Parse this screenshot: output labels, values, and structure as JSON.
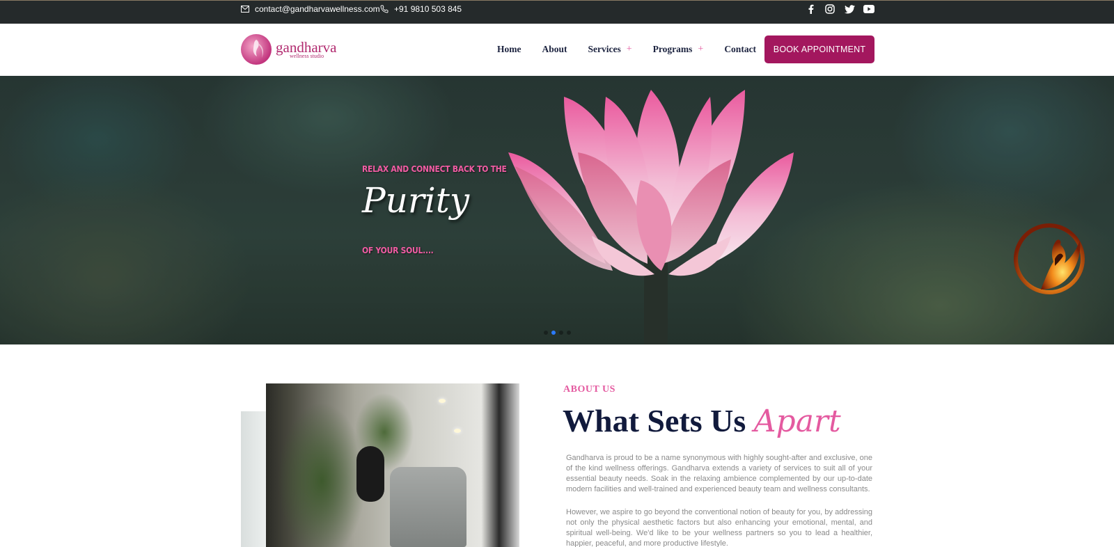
{
  "topbar": {
    "email": "contact@gandharvawellness.com",
    "phone": "+91 9810 503 845",
    "social_icons": [
      "facebook-icon",
      "instagram-icon",
      "twitter-icon",
      "youtube-icon"
    ]
  },
  "header": {
    "logo": {
      "name": "gandharva",
      "sub": "wellness studio"
    },
    "nav": [
      {
        "label": "Home",
        "has_submenu": false
      },
      {
        "label": "About",
        "has_submenu": false
      },
      {
        "label": "Services",
        "has_submenu": true
      },
      {
        "label": "Programs",
        "has_submenu": true
      },
      {
        "label": "Contact",
        "has_submenu": false
      }
    ],
    "submenu_indicator": "+",
    "book_button": "BOOK APPOINTMENT"
  },
  "hero": {
    "tagline_top": "RELAX AND CONNECT BACK TO THE",
    "title": "Purity",
    "tagline_bottom": "OF YOUR SOUL....",
    "slides_count": 4,
    "active_slide": 2
  },
  "about": {
    "label": "ABOUT US",
    "title_main": "What Sets Us",
    "title_accent": "Apart",
    "paragraph1": "Gandharva is proud to be a name synonymous with highly sought-after and exclusive, one of the kind wellness offerings. Gandharva extends a variety of services to suit all of your essential beauty needs. Soak in the relaxing ambience complemented by our up-to-date modern facilities and well-trained and experienced beauty team and wellness consultants.",
    "paragraph2": "However, we aspire to go beyond the conventional notion of beauty for you, by addressing not only the physical aesthetic factors but also enhancing your emotional, mental, and spiritual well-being. We'd like to be your wellness partners so you to lead a healthier, happier, peaceful, and more productive lifestyle."
  },
  "colors": {
    "brand": "#a3175e",
    "accent_pink": "#e45aa0",
    "navy": "#111a3c",
    "topbar_bg": "#252a2b"
  }
}
